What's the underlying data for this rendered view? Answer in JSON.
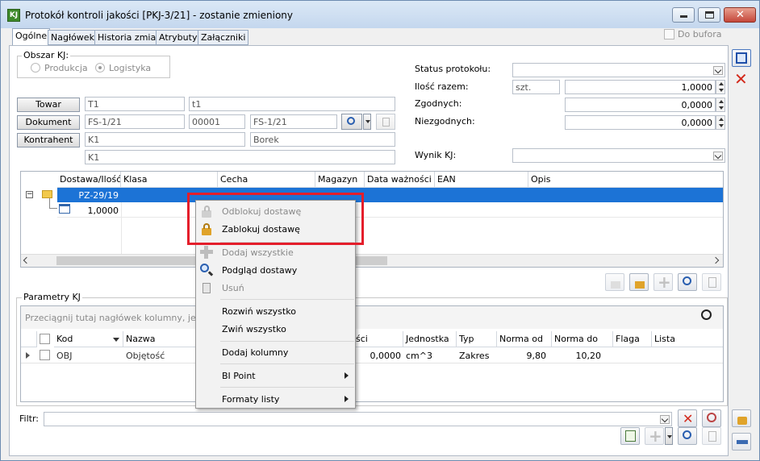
{
  "window": {
    "title": "Protokół kontroli jakości [PKJ-3/21] - zostanie zmieniony",
    "app_icon_text": "KJ"
  },
  "tabs": [
    {
      "label": "Ogólne",
      "active": true
    },
    {
      "label": "Nagłówek"
    },
    {
      "label": "Historia zmian"
    },
    {
      "label": "Atrybuty"
    },
    {
      "label": "Załączniki"
    }
  ],
  "do_bufora": "Do bufora",
  "obszar": {
    "label": "Obszar KJ:",
    "opt1": "Produkcja",
    "opt2": "Logistyka"
  },
  "right_panel": {
    "status_label": "Status protokołu:",
    "ilosc_label": "Ilość razem:",
    "ilosc_unit": "szt.",
    "ilosc_value": "1,0000",
    "zgodnych_label": "Zgodnych:",
    "zgodnych_value": "0,0000",
    "niezgodnych_label": "Niezgodnych:",
    "niezgodnych_value": "0,0000",
    "wynik_label": "Wynik KJ:"
  },
  "towar": {
    "button": "Towar",
    "code": "T1",
    "name": "t1"
  },
  "dokument": {
    "button": "Dokument",
    "doc1": "FS-1/21",
    "num": "00001",
    "doc2": "FS-1/21"
  },
  "kontrahent": {
    "button": "Kontrahent",
    "code": "K1",
    "name": "Borek",
    "line2": "K1"
  },
  "tree": {
    "headers": [
      "Dostawa/Ilość",
      "Klasa",
      "Cecha",
      "Magazyn",
      "Data ważności",
      "EAN",
      "Opis"
    ],
    "row1": "PZ-29/19",
    "row2": "1,0000"
  },
  "params": {
    "title": "Parametry KJ",
    "drag_hint": "Przeciągnij tutaj nagłówek kolumny, jeśli ma",
    "headers": [
      "Kod",
      "Nazwa",
      "ści",
      "Jednostka",
      "Typ",
      "Norma od",
      "Norma do",
      "Flaga",
      "Lista"
    ],
    "row": {
      "kod": "OBJ",
      "nazwa": "Objętość",
      "val": "0,0000",
      "jednostka": "cm^3",
      "typ": "Zakres",
      "norma_od": "9,80",
      "norma_do": "10,20"
    }
  },
  "filter_label": "Filtr:",
  "context_menu": {
    "odblokuj": "Odblokuj dostawę",
    "zablokuj": "Zablokuj dostawę",
    "dodaj_wszystkie": "Dodaj wszystkie",
    "podglad": "Podgląd dostawy",
    "usun": "Usuń",
    "rozwin": "Rozwiń wszystko",
    "zwin": "Zwiń wszystko",
    "dodaj_kolumny": "Dodaj kolumny",
    "bi_point": "BI Point",
    "formaty": "Formaty listy"
  },
  "colors": {
    "selection": "#1c73d6",
    "highlight": "#e41e2b"
  }
}
